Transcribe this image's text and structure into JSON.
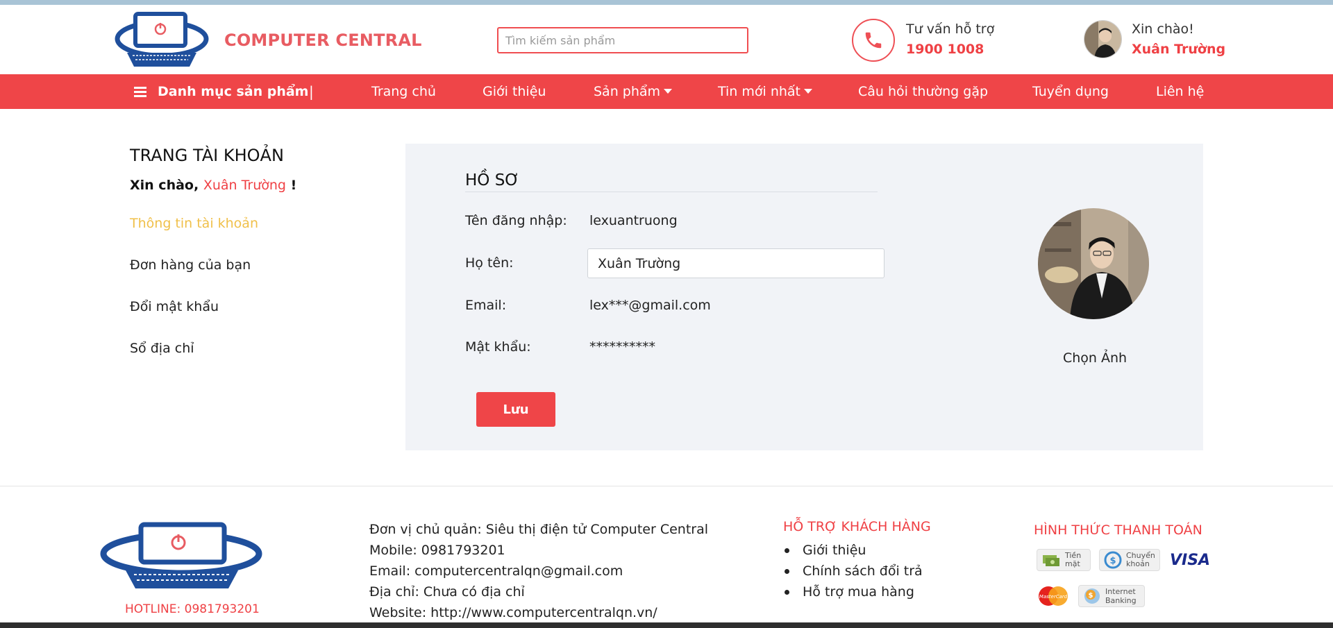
{
  "header": {
    "brand": "COMPUTER CENTRAL",
    "search_placeholder": "Tìm kiếm sản phẩm",
    "support_label": "Tư vấn hỗ trợ",
    "support_phone": "1900 1008",
    "greeting": "Xin chào!",
    "user_name": "Xuân Trường"
  },
  "nav": {
    "category_label": "Danh mục sản phẩm",
    "separator": "|",
    "items": [
      "Trang chủ",
      "Giới thiệu",
      "Sản phẩm",
      "Tin mới nhất",
      "Câu hỏi thường gặp",
      "Tuyển dụng",
      "Liên hệ"
    ]
  },
  "account": {
    "title": "TRANG TÀI KHOẢN",
    "hello_prefix": "Xin chào,",
    "hello_name": "Xuân Trường",
    "hello_suffix": "!",
    "menu": [
      "Thông tin tài khoản",
      "Đơn hàng của bạn",
      "Đổi mật khẩu",
      "Sổ địa chỉ"
    ]
  },
  "profile": {
    "title": "HỒ SƠ",
    "username_label": "Tên đăng nhập:",
    "username_value": "lexuantruong",
    "fullname_label": "Họ tên:",
    "fullname_value": "Xuân Trường",
    "email_label": "Email:",
    "email_value": "lex***@gmail.com",
    "password_label": "Mật khẩu:",
    "password_value": "**********",
    "save_label": "Lưu",
    "choose_photo": "Chọn Ảnh"
  },
  "footer": {
    "hotline": "HOTLINE: 0981793201",
    "info": [
      "Đơn vị chủ quản: Siêu thị điện tử Computer Central",
      "Mobile: 0981793201",
      "Email: computercentralqn@gmail.com",
      "Địa chỉ: Chưa có địa chỉ",
      "Website: http://www.computercentralqn.vn/"
    ],
    "support_title": "HỖ TRỢ KHÁCH HÀNG",
    "support_items": [
      "Giới thiệu",
      "Chính sách đổi trả",
      "Hỗ trợ mua hàng"
    ],
    "payment_title": "HÌNH THỨC THANH TOÁN",
    "payment": {
      "cash_1": "Tiền",
      "cash_2": "mặt",
      "transfer_1": "Chuyển",
      "transfer_2": "khoản",
      "visa": "VISA",
      "mastercard": "MasterCard",
      "ib_1": "Internet",
      "ib_2": "Banking"
    }
  },
  "colors": {
    "accent": "#ef4548",
    "active_link": "#f0c04a",
    "panel_bg": "#f1f3f7"
  }
}
